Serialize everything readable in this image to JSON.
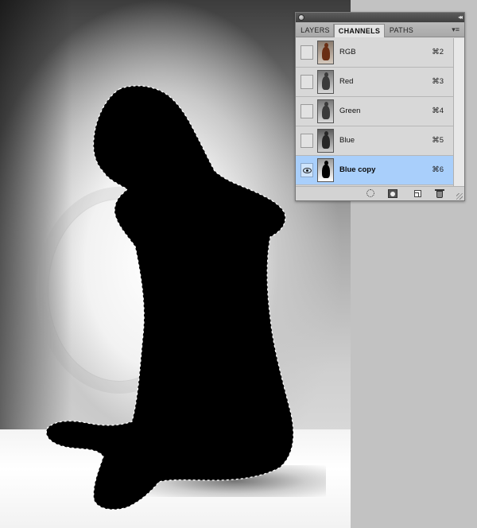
{
  "panel": {
    "tabs": [
      {
        "label": "LAYERS",
        "active": false
      },
      {
        "label": "CHANNELS",
        "active": true
      },
      {
        "label": "PATHS",
        "active": false
      }
    ],
    "menu_icon": "panel-menu-icon",
    "channels": [
      {
        "name": "RGB",
        "shortcut": "⌘2",
        "visible": false,
        "selected": false,
        "thumb": "rgb"
      },
      {
        "name": "Red",
        "shortcut": "⌘3",
        "visible": false,
        "selected": false,
        "thumb": "gray"
      },
      {
        "name": "Green",
        "shortcut": "⌘4",
        "visible": false,
        "selected": false,
        "thumb": "gray"
      },
      {
        "name": "Blue",
        "shortcut": "⌘5",
        "visible": false,
        "selected": false,
        "thumb": "blue"
      },
      {
        "name": "Blue copy",
        "shortcut": "⌘6",
        "visible": true,
        "selected": true,
        "thumb": "copy"
      }
    ],
    "footer_icons": [
      "load-selection-icon",
      "save-selection-icon",
      "new-channel-icon",
      "trash-icon"
    ]
  },
  "colors": {
    "selected_row": "#a9cffb",
    "panel_bg": "#d6d6d6",
    "workspace_bg": "#c2c2c2"
  }
}
